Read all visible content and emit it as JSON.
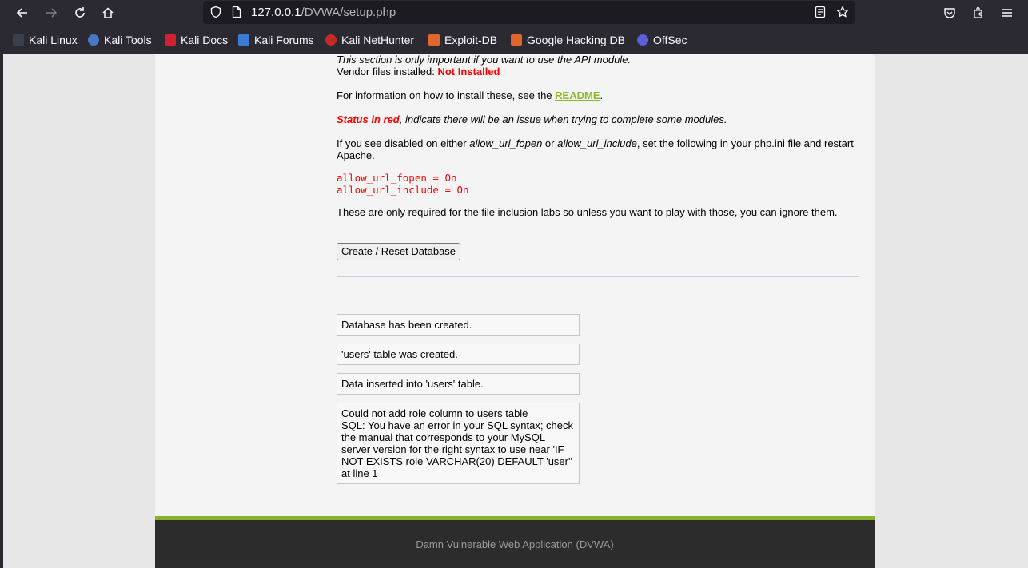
{
  "browser": {
    "url_host": "127.0.0.1",
    "url_path": "/DVWA/setup.php",
    "bookmarks": [
      "Kali Linux",
      "Kali Tools",
      "Kali Docs",
      "Kali Forums",
      "Kali NetHunter",
      "Exploit-DB",
      "Google Hacking DB",
      "OffSec"
    ],
    "icons": [
      "back-icon",
      "forward-icon",
      "reload-icon",
      "home-icon",
      "shield-icon",
      "page-icon",
      "reader-view-icon",
      "bookmark-star-icon",
      "pocket-icon",
      "extensions-icon",
      "menu-icon"
    ]
  },
  "content": {
    "api_note": "This section is only important if you want to use the API module.",
    "vendor_label": "Vendor files installed: ",
    "vendor_status": "Not Installed",
    "readme_prefix": "For information on how to install these, see the ",
    "readme_link": "README",
    "readme_suffix": ".",
    "status_red": "Status in red",
    "status_rest": ", indicate there will be an issue when trying to complete some modules.",
    "disabled_1": "If you see disabled on either ",
    "disabled_fopen": "allow_url_fopen",
    "disabled_or": " or ",
    "disabled_include": "allow_url_include",
    "disabled_2": ", set the following in your php.ini file and restart",
    "disabled_3": "Apache.",
    "code_1": "allow_url_fopen = On",
    "code_2": "allow_url_include = On",
    "fi_note": "These are only required for the file inclusion labs so unless you want to play with those, you can ignore them.",
    "button_label": "Create / Reset Database"
  },
  "messages": [
    "Database has been created.",
    "'users' table was created.",
    "Data inserted into 'users' table.",
    "Could not add role column to users table",
    "SQL: You have an error in your SQL syntax; check",
    "the manual that corresponds to your MySQL",
    "server version for the right syntax to use near 'IF",
    "NOT EXISTS role VARCHAR(20) DEFAULT 'user''",
    "at line 1"
  ],
  "footer": "Damn Vulnerable Web Application (DVWA)",
  "colors": {
    "status_red": "#ff0000",
    "link_green": "#8ab924",
    "footer_accent": "#87b32c",
    "chrome_bg": "#2b2a33"
  }
}
